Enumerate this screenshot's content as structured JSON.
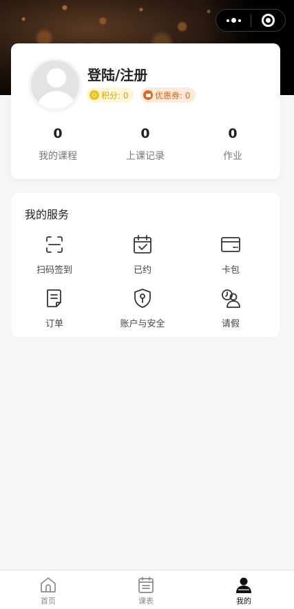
{
  "header": {
    "capsule_more_icon": "more-dots-icon",
    "capsule_close_icon": "target-circle-icon"
  },
  "profile": {
    "login_label": "登陆/注册",
    "points_label": "积分: 0",
    "coupons_label": "优惠券: 0",
    "stats": [
      {
        "value": "0",
        "label": "我的课程"
      },
      {
        "value": "0",
        "label": "上课记录"
      },
      {
        "value": "0",
        "label": "作业"
      }
    ]
  },
  "services": {
    "title": "我的服务",
    "items": [
      {
        "label": "扫码签到",
        "icon": "scan-icon"
      },
      {
        "label": "已约",
        "icon": "calendar-check-icon"
      },
      {
        "label": "卡包",
        "icon": "card-icon"
      },
      {
        "label": "订单",
        "icon": "order-document-icon"
      },
      {
        "label": "账户与安全",
        "icon": "shield-key-icon"
      },
      {
        "label": "请假",
        "icon": "user-clock-icon"
      }
    ]
  },
  "tabbar": {
    "items": [
      {
        "label": "首页",
        "icon": "home-icon",
        "active": false
      },
      {
        "label": "课表",
        "icon": "schedule-icon",
        "active": false
      },
      {
        "label": "我的",
        "icon": "user-icon",
        "active": true
      }
    ]
  },
  "colors": {
    "points_accent": "#f2c200",
    "coupon_accent": "#e2651a",
    "active_tab": "#111111",
    "inactive_tab": "#888888"
  }
}
